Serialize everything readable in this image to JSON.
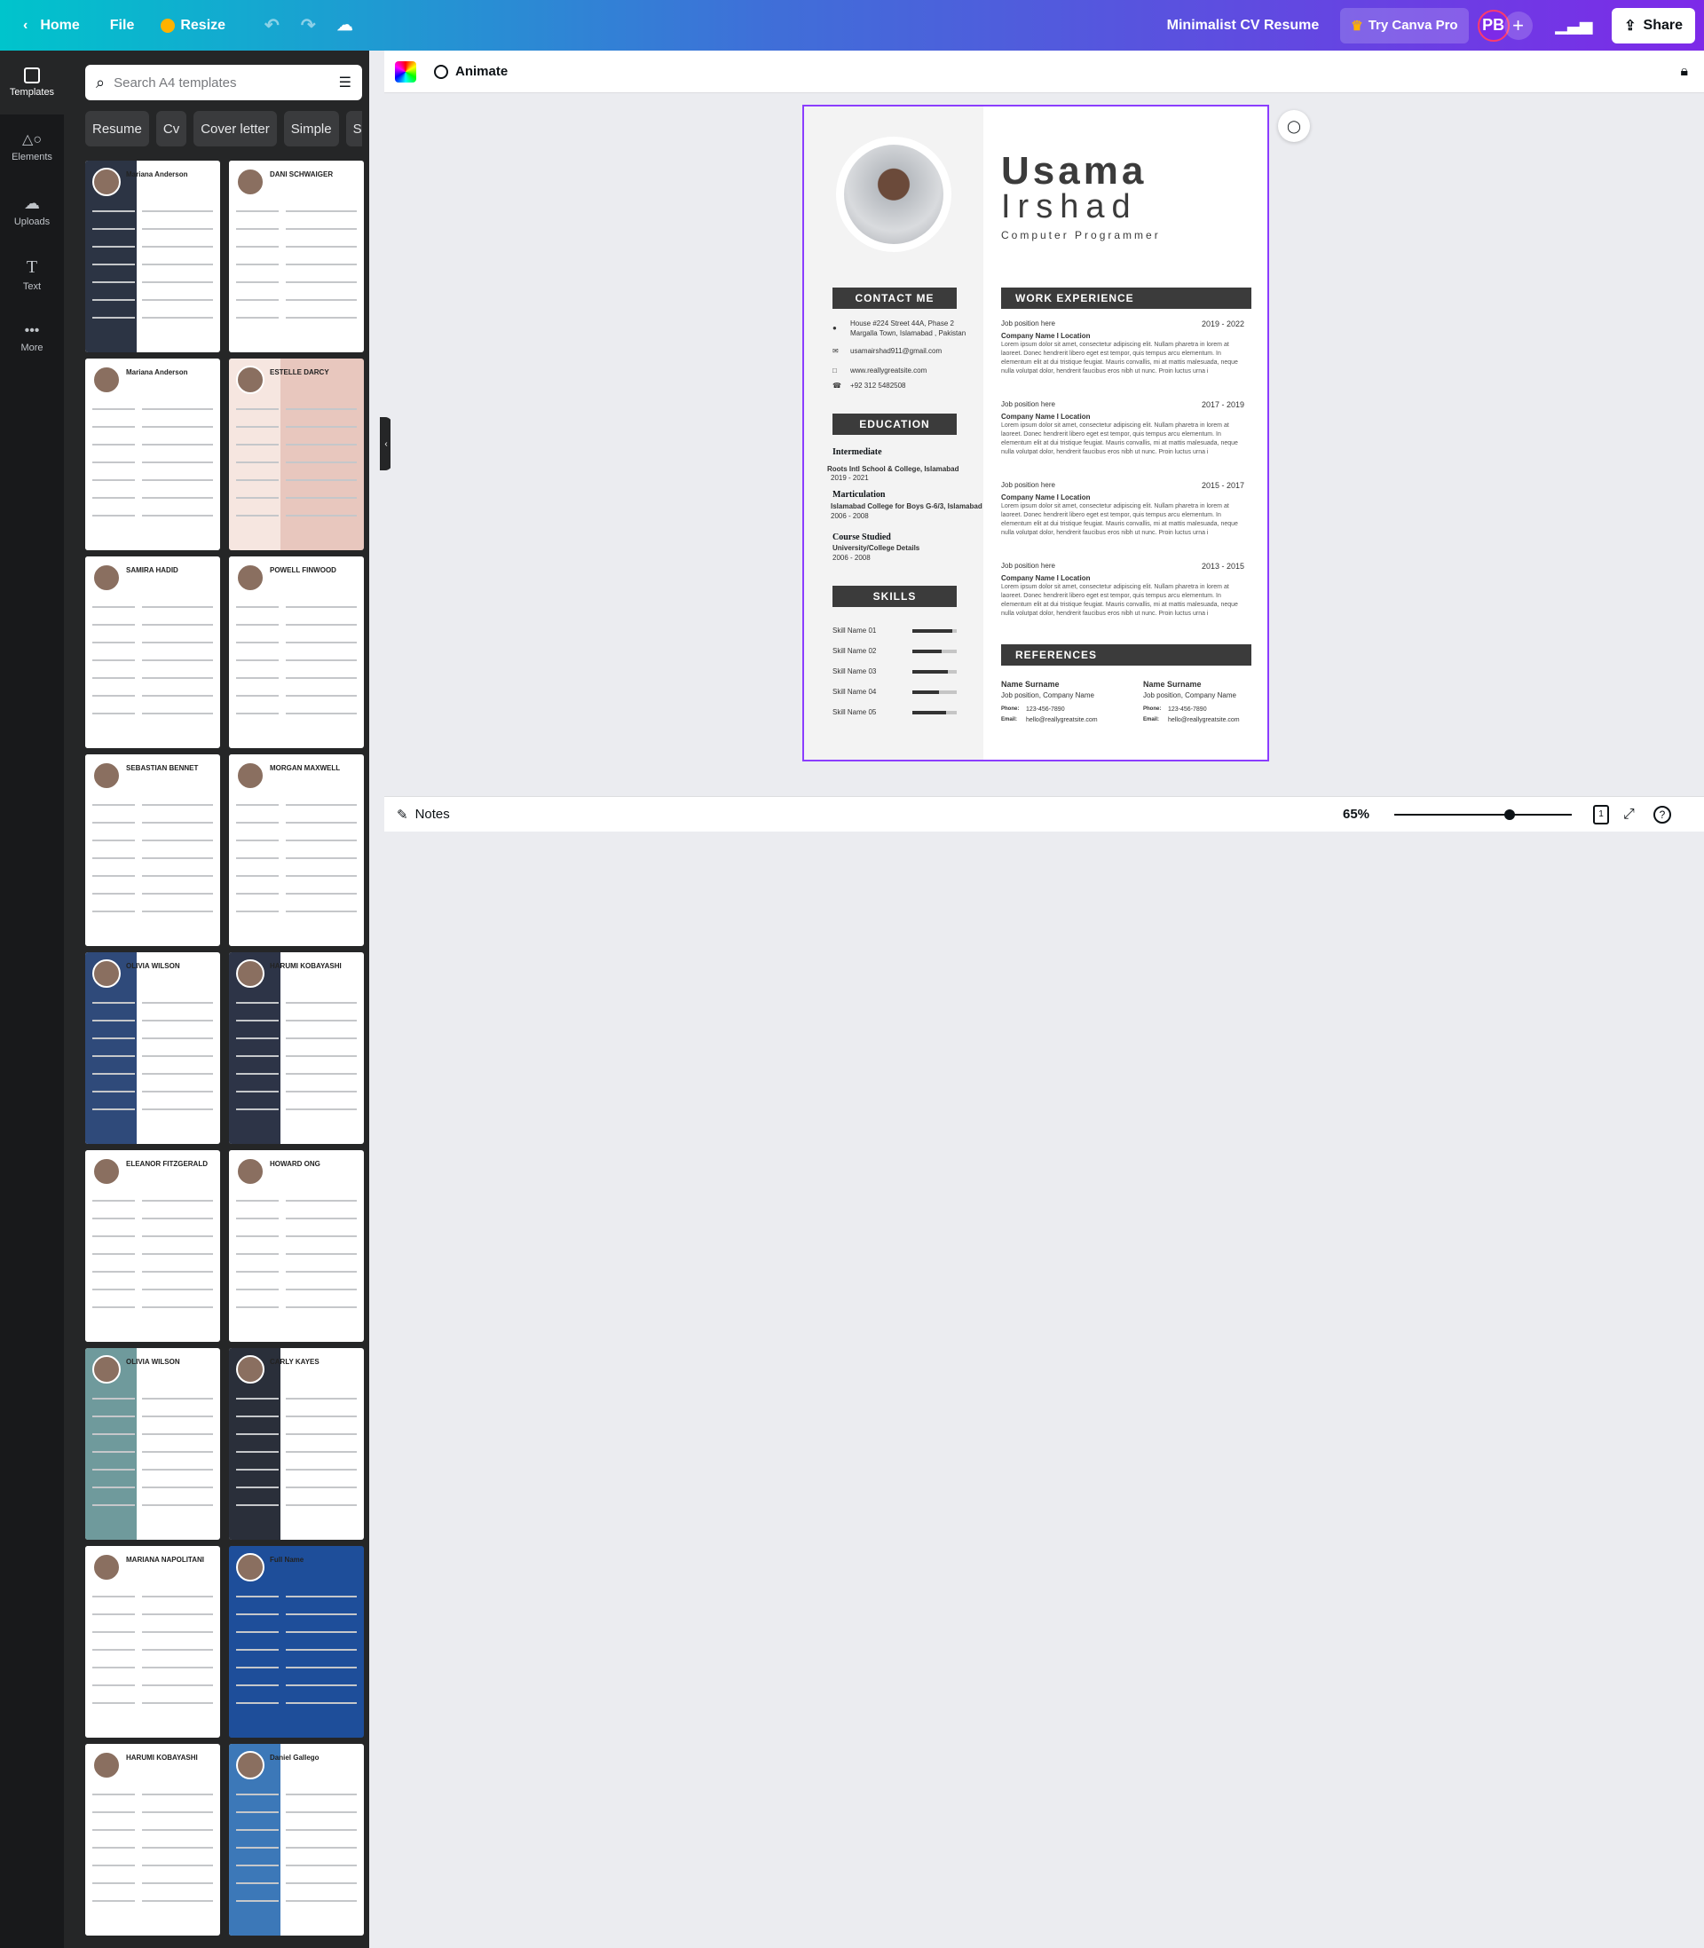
{
  "topbar": {
    "home": "Home",
    "file": "File",
    "resize": "Resize",
    "title": "Minimalist CV Resume",
    "try_pro": "Try Canva Pro",
    "avatar": "PB",
    "share": "Share"
  },
  "rail": [
    {
      "label": "Templates",
      "icon": "templates-icon"
    },
    {
      "label": "Elements",
      "icon": "elements-icon"
    },
    {
      "label": "Uploads",
      "icon": "uploads-icon"
    },
    {
      "label": "Text",
      "icon": "text-icon"
    },
    {
      "label": "More",
      "icon": "more-icon"
    }
  ],
  "panel": {
    "search_placeholder": "Search A4 templates",
    "chips": [
      "Resume",
      "Cv",
      "Cover letter",
      "Simple",
      "S"
    ]
  },
  "thumbnails": [
    {
      "name": "Mariana Anderson",
      "side": "#2c3444",
      "bg": "#ffffff"
    },
    {
      "name": "DANI SCHWAIGER",
      "side": "#ffffff",
      "bg": "#ffffff"
    },
    {
      "name": "Mariana Anderson",
      "side": "#ffffff",
      "bg": "#ffffff"
    },
    {
      "name": "ESTELLE DARCY",
      "side": "#f6e6e0",
      "bg": "#e8c7be"
    },
    {
      "name": "SAMIRA HADID",
      "side": "#ffffff",
      "bg": "#ffffff"
    },
    {
      "name": "POWELL FINWOOD",
      "side": "#ffffff",
      "bg": "#ffffff"
    },
    {
      "name": "SEBASTIAN BENNET",
      "side": "#ffffff",
      "bg": "#ffffff"
    },
    {
      "name": "MORGAN MAXWELL",
      "side": "#ffffff",
      "bg": "#ffffff"
    },
    {
      "name": "OLIVIA WILSON",
      "side": "#2f4a7a",
      "bg": "#ffffff"
    },
    {
      "name": "HARUMI KOBAYASHI",
      "side": "#2d3447",
      "bg": "#ffffff"
    },
    {
      "name": "ELEANOR FITZGERALD",
      "side": "#ffffff",
      "bg": "#ffffff"
    },
    {
      "name": "HOWARD ONG",
      "side": "#ffffff",
      "bg": "#ffffff"
    },
    {
      "name": "OLIVIA WILSON",
      "side": "#6f9a9c",
      "bg": "#ffffff"
    },
    {
      "name": "CARLY KAYES",
      "side": "#2a2f3a",
      "bg": "#ffffff"
    },
    {
      "name": "MARIANA NAPOLITANI",
      "side": "#ffffff",
      "bg": "#ffffff"
    },
    {
      "name": "Full Name",
      "side": "#1e4e9a",
      "bg": "#1e4e9a"
    },
    {
      "name": "HARUMI KOBAYASHI",
      "side": "#ffffff",
      "bg": "#ffffff"
    },
    {
      "name": "Daniel Gallego",
      "side": "#3c78b8",
      "bg": "#ffffff"
    }
  ],
  "canvas_toolbar": {
    "animate": "Animate"
  },
  "resume": {
    "first": "Usama",
    "last": "Irshad",
    "role": "Computer Programmer",
    "contact_header": "CONTACT ME",
    "address": "House #224 Street 44A, Phase 2 Margalla Town, Islamabad , Pakistan",
    "email": "usamairshad911@gmail.com",
    "website": "www.reallygreatsite.com",
    "phone": "+92 312 5482508",
    "education_header": "EDUCATION",
    "edu": [
      {
        "title": "Intermediate",
        "place": "Roots Intl School &  College, Islamabad",
        "years": "2019 - 2021"
      },
      {
        "title": "Marticulation",
        "place": "Islamabad College for Boys G-6/3, Islamabad",
        "years": "2006 - 2008"
      },
      {
        "title": "Course Studied",
        "place": "University/College Details",
        "years": "2006 - 2008"
      }
    ],
    "skills_header": "SKILLS",
    "skills": [
      {
        "name": "Skill Name 01",
        "level": 0.9
      },
      {
        "name": "Skill Name 02",
        "level": 0.65
      },
      {
        "name": "Skill Name 03",
        "level": 0.8
      },
      {
        "name": "Skill Name 04",
        "level": 0.6
      },
      {
        "name": "Skill Name 05",
        "level": 0.75
      }
    ],
    "work_header": "WORK EXPERIENCE",
    "jobs": [
      {
        "position": "Job position here",
        "company": "Company Name I Location",
        "years": "2019 - 2022"
      },
      {
        "position": "Job position here",
        "company": "Company Name I Location",
        "years": "2017 - 2019"
      },
      {
        "position": "Job position here",
        "company": "Company Name I Location",
        "years": "2015 - 2017"
      },
      {
        "position": "Job position here",
        "company": "Company Name I Location",
        "years": "2013 - 2015"
      }
    ],
    "lorem": "Lorem ipsum dolor sit amet, consectetur adipiscing elit. Nullam pharetra in lorem at laoreet. Donec hendrerit libero eget est tempor, quis tempus arcu elementum. In elementum elit at dui tristique feugiat. Mauris convallis, mi at mattis malesuada, neque nulla volutpat dolor, hendrerit faucibus eros nibh ut nunc. Proin luctus urna i",
    "references_header": "REFERENCES",
    "refs": [
      {
        "name": "Name Surname",
        "position": "Job position, Company Name",
        "phone_label": "Phone:",
        "phone": "123-456-7890",
        "email_label": "Email:",
        "email": "hello@reallygreatsite.com"
      },
      {
        "name": "Name Surname",
        "position": "Job position, Company Name",
        "phone_label": "Phone:",
        "phone": "123-456-7890",
        "email_label": "Email:",
        "email": "hello@reallygreatsite.com"
      }
    ]
  },
  "bottombar": {
    "notes": "Notes",
    "zoom": "65%",
    "zoom_level": 0.65,
    "page_number": "1"
  }
}
